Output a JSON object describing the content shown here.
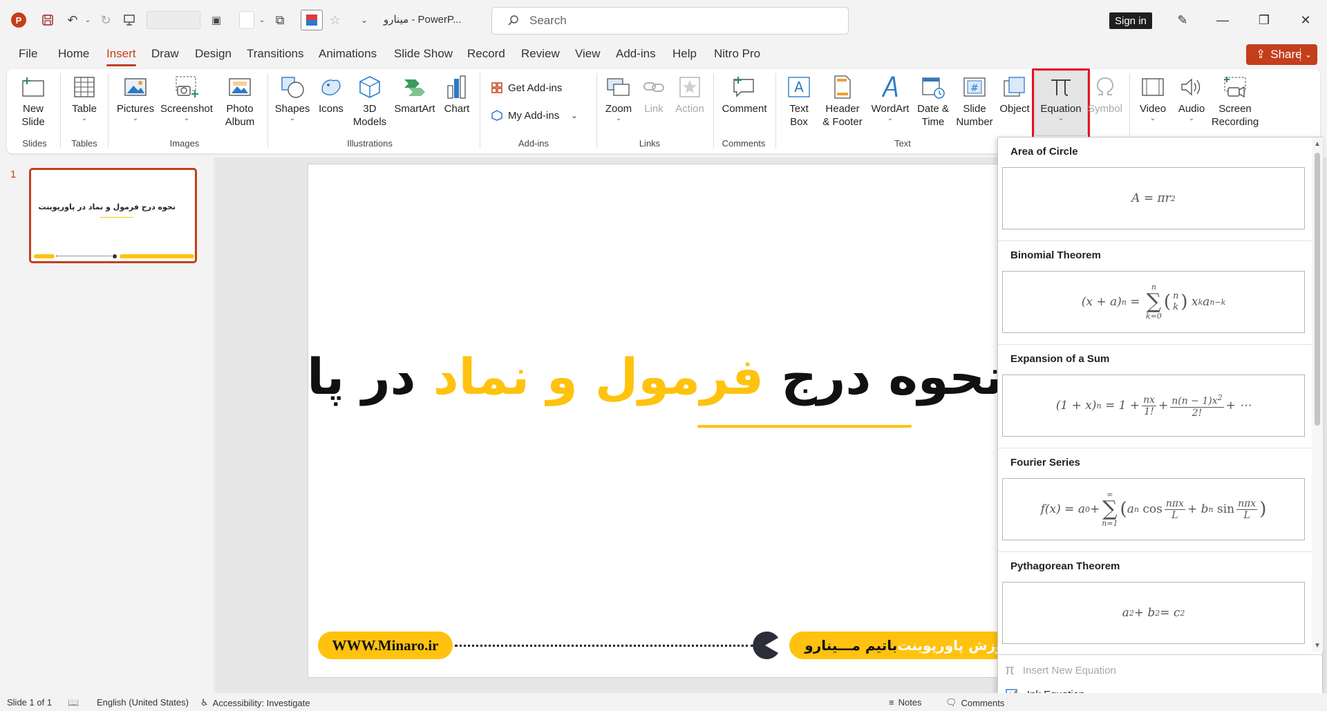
{
  "app": {
    "logo_letter": "P",
    "title": "مینارو  -  PowerP...",
    "search_placeholder": "Search",
    "sign_in": "Sign in",
    "share": "Share"
  },
  "tabs": [
    "File",
    "Home",
    "Insert",
    "Draw",
    "Design",
    "Transitions",
    "Animations",
    "Slide Show",
    "Record",
    "Review",
    "View",
    "Add-ins",
    "Help",
    "Nitro Pro"
  ],
  "active_tab": "Insert",
  "ribbon": {
    "new_slide": "New\nSlide",
    "table": "Table",
    "pictures": "Pictures",
    "screenshot": "Screenshot",
    "photo_album": "Photo\nAlbum",
    "shapes": "Shapes",
    "icons": "Icons",
    "models_3d": "3D\nModels",
    "smartart": "SmartArt",
    "chart": "Chart",
    "get_addins": "Get Add-ins",
    "my_addins": "My Add-ins",
    "zoom": "Zoom",
    "link": "Link",
    "action": "Action",
    "comment": "Comment",
    "text_box": "Text\nBox",
    "header_footer": "Header\n& Footer",
    "wordart": "WordArt",
    "date_time": "Date &\nTime",
    "slide_number": "Slide\nNumber",
    "object": "Object",
    "equation": "Equation",
    "symbol": "Symbol",
    "video": "Video",
    "audio": "Audio",
    "screen_recording": "Screen\nRecording",
    "groups": {
      "slides": "Slides",
      "tables": "Tables",
      "images": "Images",
      "illustrations": "Illustrations",
      "addins": "Add-ins",
      "links": "Links",
      "comments": "Comments",
      "text": "Text"
    }
  },
  "slides_pane": {
    "slide_number": "1",
    "thumb_title": "نحوه درج فرمول و نماد در پاورپوینت"
  },
  "slide": {
    "title_pre": "نحوه درج ",
    "title_highlight": "فرمول و نماد",
    "title_post": " در پاورپوینت",
    "website": "WWW.Minaro.ir",
    "footer_highlight": "آموزش پاورپوینت",
    "footer_rest": " باتیم مـــینارو"
  },
  "equations": {
    "items": [
      {
        "title": "Area of Circle"
      },
      {
        "title": "Binomial Theorem"
      },
      {
        "title": "Expansion of a Sum"
      },
      {
        "title": "Fourier Series"
      },
      {
        "title": "Pythagorean Theorem"
      }
    ],
    "insert_new": "Insert New Equation",
    "ink": "Ink Equation"
  },
  "status": {
    "slide_of": "Slide 1 of 1",
    "language": "English (United States)",
    "accessibility": "Accessibility: Investigate",
    "notes": "Notes",
    "comments": "Comments"
  },
  "colors": {
    "accent": "#c43e1c",
    "highlight": "#ffc20e",
    "callout": "#e81123"
  }
}
